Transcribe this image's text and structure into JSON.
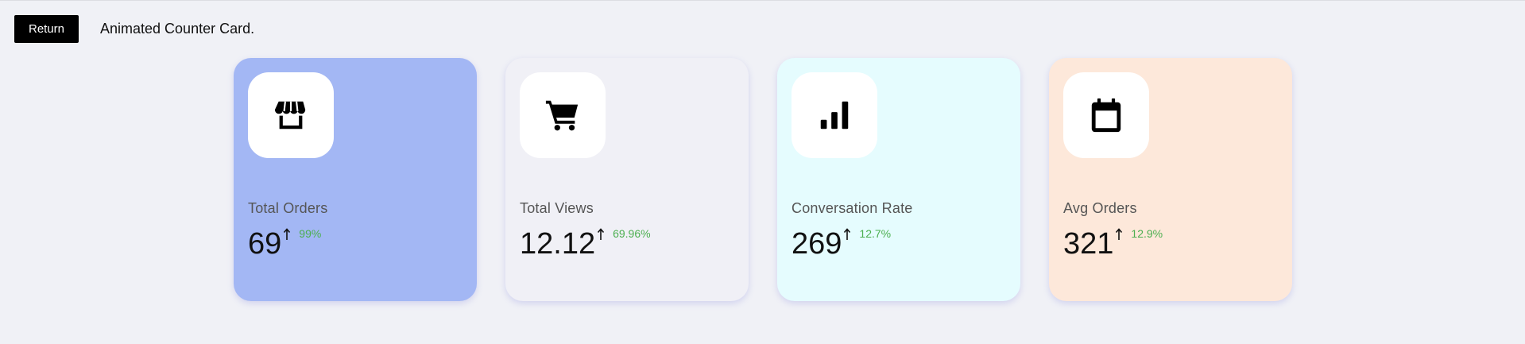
{
  "header": {
    "return_label": "Return",
    "title": "Animated Counter Card."
  },
  "cards": [
    {
      "label": "Total Orders",
      "value": "69",
      "change": "99%",
      "icon": "store-icon",
      "bg": "#a3b7f4"
    },
    {
      "label": "Total Views",
      "value": "12.12",
      "change": "69.96%",
      "icon": "cart-icon",
      "bg": "#f0f0f6"
    },
    {
      "label": "Conversation Rate",
      "value": "269",
      "change": "12.7%",
      "icon": "bar-chart-icon",
      "bg": "#e5fcfe"
    },
    {
      "label": "Avg Orders",
      "value": "321",
      "change": "12.9%",
      "icon": "calendar-icon",
      "bg": "#fde8da"
    }
  ],
  "colors": {
    "page_bg": "#f0f1f6",
    "change_positive": "#4caf50",
    "button_bg": "#000000"
  }
}
